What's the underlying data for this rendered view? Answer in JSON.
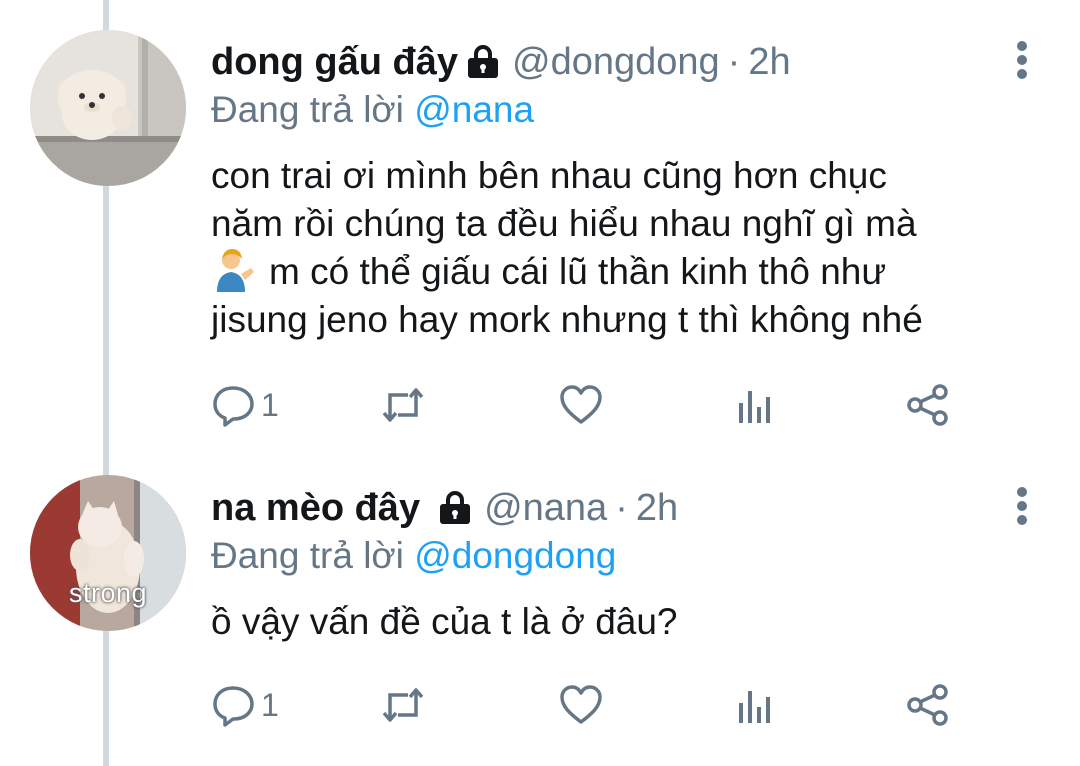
{
  "tweets": [
    {
      "display_name": "dong gấu đây",
      "handle": "@dongdong",
      "separator": "·",
      "time": "2h",
      "reply_prefix": "Đang trả lời",
      "reply_to": "@nana",
      "avatar_caption": "",
      "body_lines": [
        "con trai ơi mình bên nhau cũng hơn chục",
        "năm rồi chúng ta đều hiểu nhau nghĩ gì mà",
        "m có thể giấu cái lũ thần kinh thô như",
        "jisung jeno hay mork nhưng t thì không nhé"
      ],
      "reply_count": "1"
    },
    {
      "display_name": "na mèo đây",
      "handle": "@nana",
      "separator": "·",
      "time": "2h",
      "reply_prefix": "Đang trả lời",
      "reply_to": "@dongdong",
      "avatar_caption": "strong",
      "body_lines": [
        "ồ vậy vấn đề của t là ở đâu?"
      ],
      "reply_count": "1"
    }
  ],
  "icons": {
    "lock": "lock-icon",
    "more": "more-vertical-icon",
    "reply": "reply-icon",
    "retweet": "retweet-icon",
    "like": "heart-icon",
    "stats": "analytics-icon",
    "share": "share-icon",
    "emoji": "person-tipping-hand-emoji"
  },
  "colors": {
    "link": "#1da1f2",
    "secondary": "#657786",
    "text": "#14171a",
    "thread_line": "#cfd9de"
  }
}
